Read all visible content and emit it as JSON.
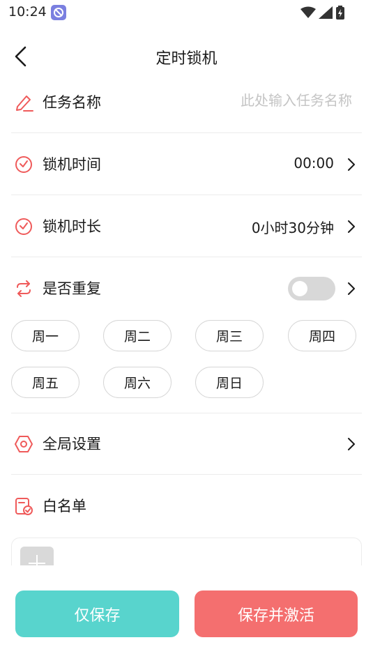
{
  "status_bar": {
    "time": "10:24"
  },
  "header": {
    "title": "定时锁机"
  },
  "task_name": {
    "label": "任务名称",
    "placeholder": "此处输入任务名称",
    "value": ""
  },
  "lock_time": {
    "label": "锁机时间",
    "value": "00:00"
  },
  "lock_duration": {
    "label": "锁机时长",
    "value": "0小时30分钟"
  },
  "repeat": {
    "label": "是否重复",
    "enabled": false
  },
  "days": [
    "周一",
    "周二",
    "周三",
    "周四",
    "周五",
    "周六",
    "周日"
  ],
  "global_settings": {
    "label": "全局设置"
  },
  "whitelist": {
    "label": "白名单"
  },
  "buttons": {
    "save_only": "仅保存",
    "save_and_activate": "保存并激活"
  },
  "colors": {
    "accent_red": "#f46f6f",
    "accent_teal": "#58d4cd",
    "icon_red": "#ef5a5a"
  }
}
